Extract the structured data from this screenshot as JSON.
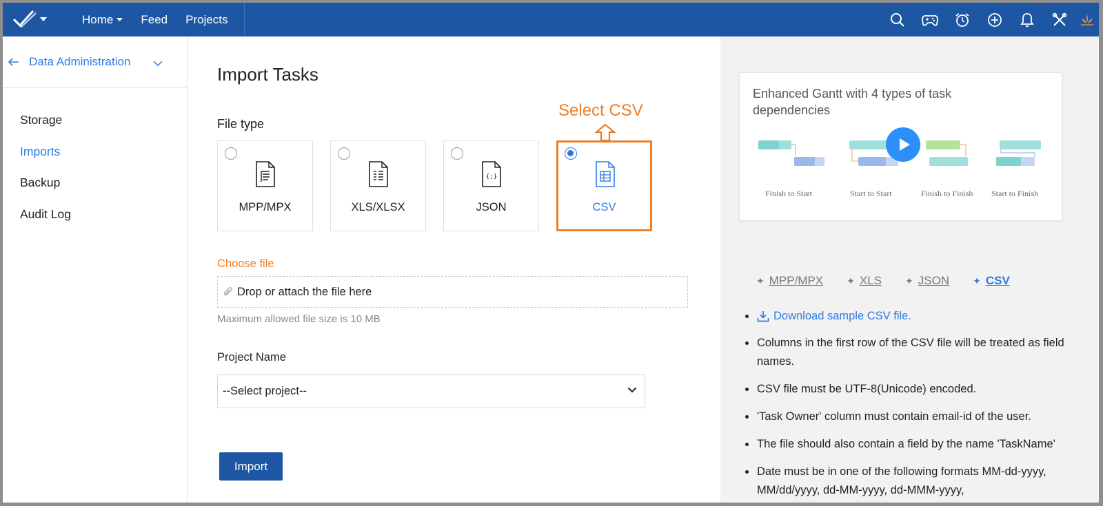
{
  "nav": {
    "home": "Home",
    "feed": "Feed",
    "projects": "Projects"
  },
  "sidebar": {
    "title": "Data Administration",
    "items": [
      {
        "label": "Storage"
      },
      {
        "label": "Imports"
      },
      {
        "label": "Backup"
      },
      {
        "label": "Audit Log"
      }
    ]
  },
  "main": {
    "title": "Import Tasks",
    "file_type_label": "File type",
    "annotation": "Select CSV",
    "file_types": [
      {
        "label": "MPP/MPX",
        "selected": false
      },
      {
        "label": "XLS/XLSX",
        "selected": false
      },
      {
        "label": "JSON",
        "selected": false
      },
      {
        "label": "CSV",
        "selected": true
      }
    ],
    "choose_file_label": "Choose file",
    "dropzone_text": "Drop or attach the file here",
    "file_size_hint": "Maximum allowed file size is 10 MB",
    "project_label": "Project Name",
    "project_select_value": "--Select project--",
    "import_button": "Import"
  },
  "right": {
    "video_title": "Enhanced Gantt with 4 types of task dependencies",
    "dependency_labels": [
      "Finish to Start",
      "Start to Start",
      "Finish to Finish",
      "Start to Finish"
    ],
    "format_tabs": [
      {
        "label": "MPP/MPX",
        "active": false
      },
      {
        "label": "XLS",
        "active": false
      },
      {
        "label": "JSON",
        "active": false
      },
      {
        "label": "CSV",
        "active": true
      }
    ],
    "download_link": "Download sample CSV file.",
    "rules": [
      "Columns in the first row of the CSV file will be treated as field names.",
      "CSV file must be UTF-8(Unicode) encoded.",
      "'Task Owner' column must contain email-id of the user.",
      "The file should also contain a field by the name 'TaskName'",
      "Date must be in one of the following formats MM-dd-yyyy, MM/dd/yyyy, dd-MM-yyyy, dd-MMM-yyyy,"
    ]
  },
  "colors": {
    "topbar": "#1d57a3",
    "accent_blue": "#2c7be5",
    "annotation_orange": "#f07d22",
    "right_panel_bg": "#f2f2f2"
  }
}
